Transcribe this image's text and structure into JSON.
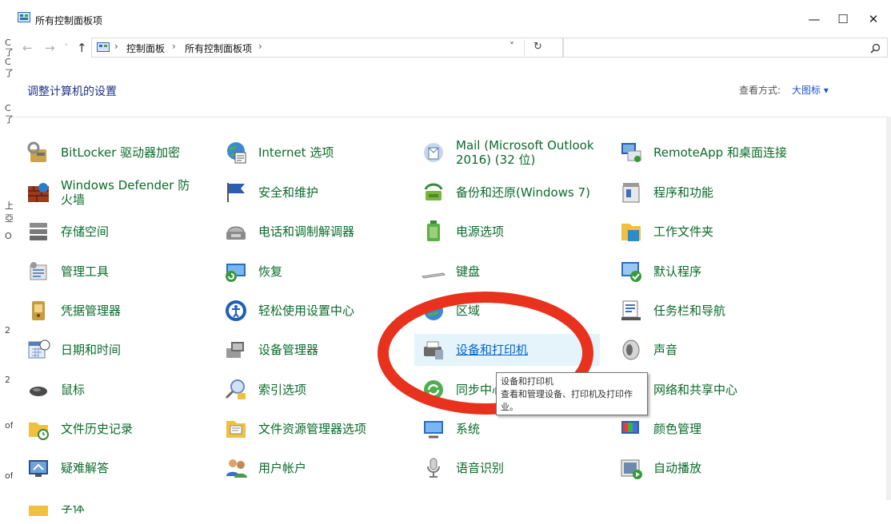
{
  "window": {
    "title": "所有控制面板项",
    "controls": {
      "minimize": "—",
      "maximize": "☐",
      "close": "✕"
    }
  },
  "left_strip": [
    "C",
    "了",
    "C",
    "了",
    "C",
    "了",
    "上",
    "亞",
    "O",
    "2",
    "2",
    "of",
    "of"
  ],
  "nav": {
    "back": "←",
    "forward": "→",
    "dropdown": "˅",
    "up": "↑",
    "breadcrumb": [
      "控制面板",
      "所有控制面板项"
    ],
    "separator": "›",
    "addr_dropdown": "˅",
    "refresh": "↻",
    "search_placeholder": "",
    "search_icon": "⚲"
  },
  "header": {
    "title": "调整计算机的设置",
    "view_by_label": "查看方式:",
    "view_by_value": "大图标 ▾"
  },
  "items": [
    [
      {
        "label": "BitLocker 驱动器加密",
        "icon": "bitlocker-icon"
      },
      {
        "label": "Windows Defender 防火墙",
        "icon": "firewall-icon"
      },
      {
        "label": "存储空间",
        "icon": "storage-spaces-icon"
      },
      {
        "label": "管理工具",
        "icon": "admin-tools-icon"
      },
      {
        "label": "凭据管理器",
        "icon": "credential-manager-icon"
      },
      {
        "label": "日期和时间",
        "icon": "date-time-icon"
      },
      {
        "label": "鼠标",
        "icon": "mouse-icon"
      },
      {
        "label": "文件历史记录",
        "icon": "file-history-icon"
      },
      {
        "label": "疑难解答",
        "icon": "troubleshooting-icon"
      },
      {
        "label": "字体",
        "icon": "fonts-icon"
      }
    ],
    [
      {
        "label": "Internet 选项",
        "icon": "internet-options-icon"
      },
      {
        "label": "安全和维护",
        "icon": "security-maintenance-icon"
      },
      {
        "label": "电话和调制解调器",
        "icon": "phone-modem-icon"
      },
      {
        "label": "恢复",
        "icon": "recovery-icon"
      },
      {
        "label": "轻松使用设置中心",
        "icon": "ease-of-access-icon"
      },
      {
        "label": "设备管理器",
        "icon": "device-manager-icon"
      },
      {
        "label": "索引选项",
        "icon": "indexing-options-icon"
      },
      {
        "label": "文件资源管理器选项",
        "icon": "file-explorer-options-icon"
      },
      {
        "label": "用户帐户",
        "icon": "user-accounts-icon"
      }
    ],
    [
      {
        "label": "Mail (Microsoft Outlook 2016) (32 位)",
        "icon": "mail-icon"
      },
      {
        "label": "备份和还原(Windows 7)",
        "icon": "backup-restore-icon"
      },
      {
        "label": "电源选项",
        "icon": "power-options-icon"
      },
      {
        "label": "键盘",
        "icon": "keyboard-icon"
      },
      {
        "label": "区域",
        "icon": "region-icon"
      },
      {
        "label": "设备和打印机",
        "icon": "devices-printers-icon"
      },
      {
        "label": "同步中心",
        "icon": "sync-center-icon"
      },
      {
        "label": "系统",
        "icon": "system-icon"
      },
      {
        "label": "语音识别",
        "icon": "speech-recognition-icon"
      }
    ],
    [
      {
        "label": "RemoteApp 和桌面连接",
        "icon": "remoteapp-icon"
      },
      {
        "label": "程序和功能",
        "icon": "programs-features-icon"
      },
      {
        "label": "工作文件夹",
        "icon": "work-folders-icon"
      },
      {
        "label": "默认程序",
        "icon": "default-programs-icon"
      },
      {
        "label": "任务栏和导航",
        "icon": "taskbar-navigation-icon"
      },
      {
        "label": "声音",
        "icon": "sound-icon"
      },
      {
        "label": "网络和共享中心",
        "icon": "network-sharing-icon"
      },
      {
        "label": "颜色管理",
        "icon": "color-management-icon"
      },
      {
        "label": "自动播放",
        "icon": "autoplay-icon"
      }
    ]
  ],
  "highlighted": "设备和打印机",
  "tooltip": {
    "title": "设备和打印机",
    "body": "查看和管理设备、打印机及打印作业。"
  },
  "colors": {
    "link_green": "#0a6b2a",
    "link_blue": "#0066cc",
    "heading_blue": "#1e3287",
    "annotation_red": "#e8321e",
    "highlight_bg": "#e5f3fb"
  }
}
